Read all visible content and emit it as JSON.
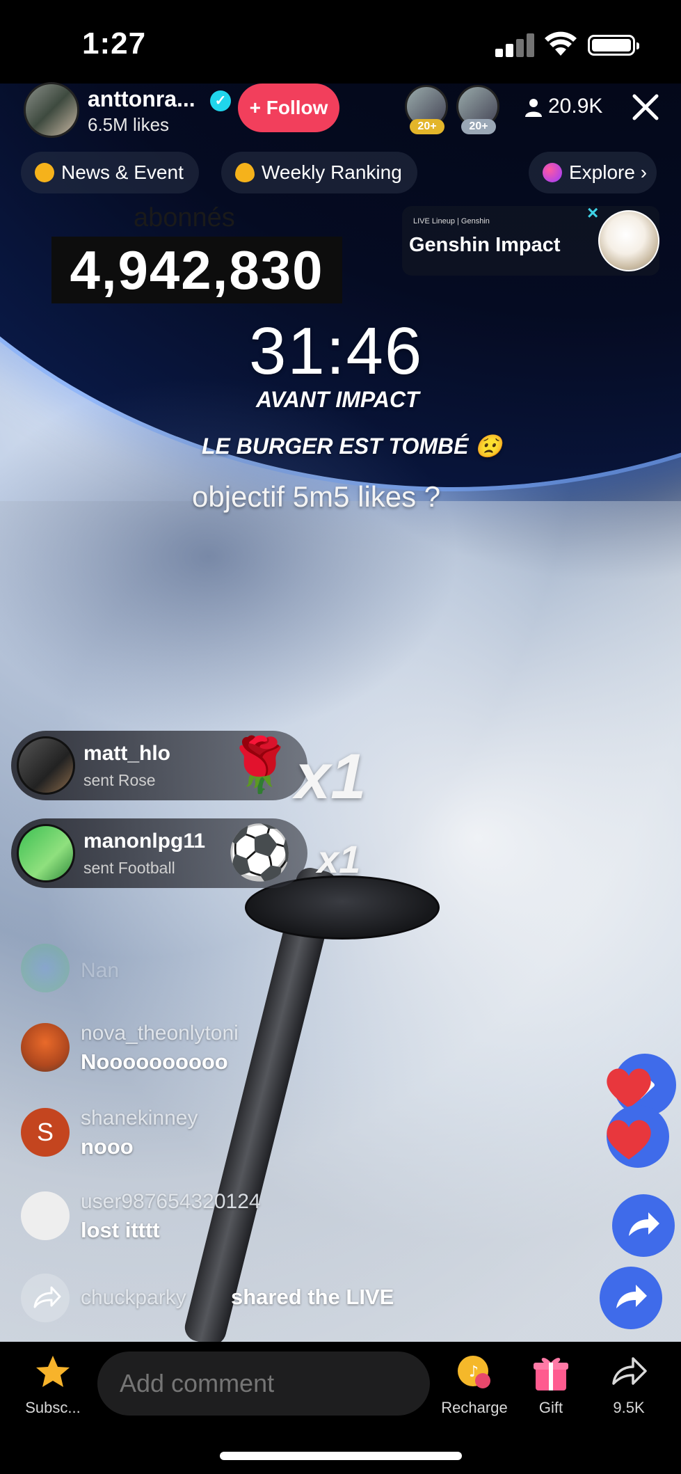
{
  "status": {
    "time": "1:27"
  },
  "host": {
    "name": "anttonra...",
    "likes": "6.5M likes",
    "follow_label": "+ Follow"
  },
  "viewers": {
    "badges": [
      "20+",
      "20+"
    ],
    "count": "20.9K"
  },
  "top_pills": {
    "news": "News & Event",
    "ranking": "Weekly Ranking",
    "explore": "Explore ›"
  },
  "overlay": {
    "abonnes_label": "abonnés",
    "subscriber_count": "4,942,830",
    "timer": "31:46",
    "avant_impact": "AVANT IMPACT",
    "burger": "LE BURGER EST TOMBÉ 😟",
    "objectif": "objectif 5m5 likes ?"
  },
  "promo": {
    "subtitle": "LIVE Lineup | Genshin",
    "title": "Genshin Impact",
    "close": "×"
  },
  "gifts": [
    {
      "user": "matt_hlo",
      "action": "sent Rose",
      "item": "🌹",
      "multiplier": "x1"
    },
    {
      "user": "manonlpg11",
      "action": "sent Football",
      "item": "⚽",
      "multiplier": "x1"
    }
  ],
  "comments": [
    {
      "user": "Nan",
      "text": ""
    },
    {
      "user": "nova_theonlytoni",
      "text": "Noooooooooo"
    },
    {
      "user": "shanekinney",
      "text": "nooo",
      "initial": "S"
    },
    {
      "user": "user987654320124",
      "text": "lost itttt"
    },
    {
      "user": "chuckparky",
      "text": "shared the LIVE"
    }
  ],
  "bottom_bar": {
    "subscribe": "Subsc...",
    "comment_placeholder": "Add comment",
    "recharge": "Recharge",
    "gift": "Gift",
    "share_count": "9.5K"
  },
  "colors": {
    "follow": "#f23f5c",
    "accent_blue": "#3f6bea",
    "verified": "#20d5ec"
  },
  "icons": {
    "subscribe": "star-icon",
    "recharge": "coin-icon",
    "gift": "gift-box-icon",
    "share": "share-arrow-icon"
  }
}
